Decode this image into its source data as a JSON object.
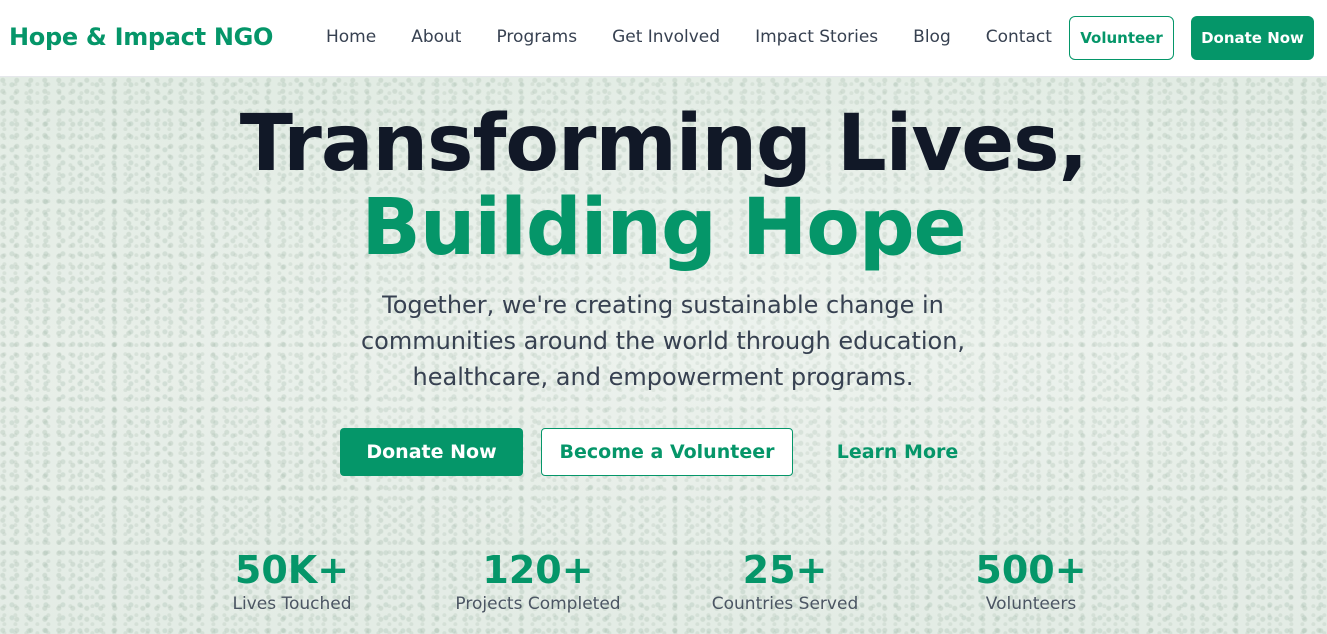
{
  "brand": {
    "name": "Hope & Impact NGO"
  },
  "nav": {
    "links": [
      "Home",
      "About",
      "Programs",
      "Get Involved",
      "Impact Stories",
      "Blog",
      "Contact"
    ],
    "volunteer_label": "Volunteer",
    "donate_label": "Donate Now"
  },
  "hero": {
    "title_line1": "Transforming Lives,",
    "title_line2": "Building Hope",
    "subtitle": "Together, we're creating sustainable change in communities around the world through education, healthcare, and empowerment programs.",
    "donate_label": "Donate Now",
    "volunteer_label": "Become a Volunteer",
    "learn_label": "Learn More"
  },
  "stats": [
    {
      "value": "50K+",
      "label": "Lives Touched"
    },
    {
      "value": "120+",
      "label": "Projects Completed"
    },
    {
      "value": "25+",
      "label": "Countries Served"
    },
    {
      "value": "500+",
      "label": "Volunteers"
    }
  ],
  "colors": {
    "accent": "#059669",
    "heading": "#111827",
    "text": "#374151"
  }
}
